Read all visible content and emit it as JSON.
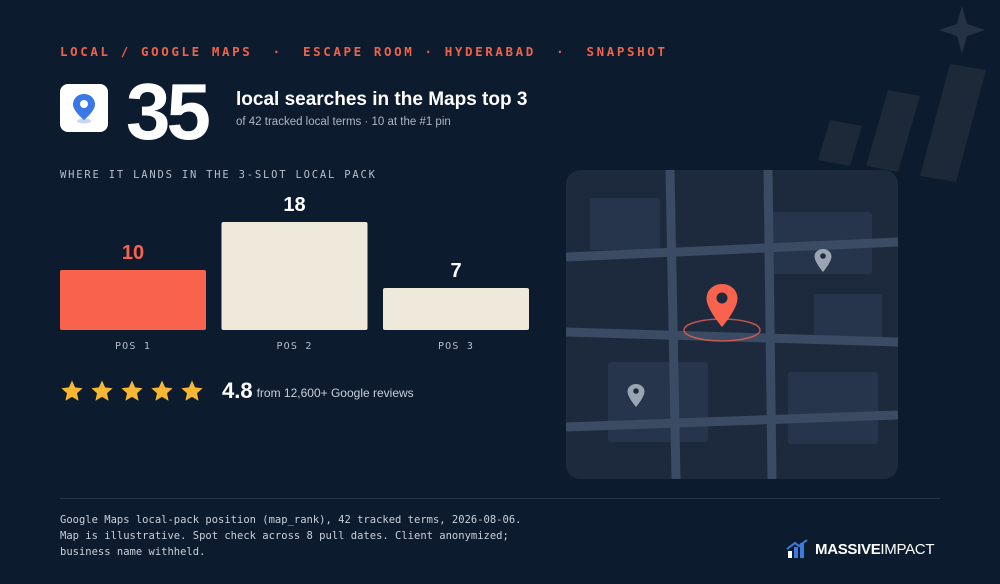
{
  "header": {
    "kicker": "LOCAL / GOOGLE MAPS  ·  ESCAPE ROOM · HYDERABAD  ·  SNAPSHOT"
  },
  "hero": {
    "big_number": "35",
    "headline": "local searches in the Maps top 3",
    "subhead": "of 42 tracked local terms · 10 at the #1 pin"
  },
  "chart_caption": "WHERE IT LANDS IN THE 3-SLOT LOCAL PACK",
  "chart_data": {
    "type": "bar",
    "categories": [
      "POS 1",
      "POS 2",
      "POS 3"
    ],
    "values": [
      10,
      18,
      7
    ],
    "data_labels": [
      "10",
      "18",
      "7"
    ],
    "colors": [
      "#f9634d",
      "#efe9dc",
      "#efe9dc"
    ],
    "label_colors": [
      "#f9634d",
      "#ffffff",
      "#ffffff"
    ],
    "ylim": [
      0,
      18
    ],
    "title": "",
    "xlabel": "",
    "ylabel": "",
    "grid": false,
    "legend": "none"
  },
  "rating": {
    "stars": 5,
    "value": "4.8",
    "caption": "from 12,600+ Google reviews",
    "star_color": "#f7b733"
  },
  "map": {
    "main_pin_icon": "map-pin-icon",
    "main_pin_color": "#f9634d",
    "secondary_pin_color": "#9aa4b2"
  },
  "footnote": {
    "line1": "Google Maps local-pack position (map_rank), 42 tracked terms, 2026-08-06.",
    "line2": "Map is illustrative. Spot check across 8 pull dates. Client anonymized;",
    "line3": "business name withheld."
  },
  "brand": {
    "name_bold": "MASSIVE",
    "name_light": "IMPACT",
    "icon": "bar-chart-logo-icon",
    "accent": "#3d7be0"
  }
}
